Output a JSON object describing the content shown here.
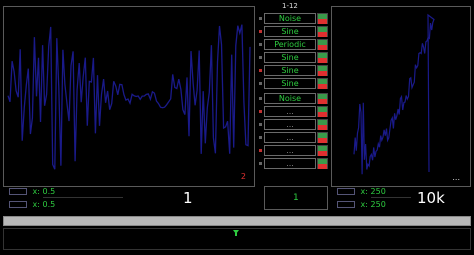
{
  "channel_range_label": "1-12",
  "channels": [
    {
      "label": "Noise",
      "dim": false
    },
    {
      "label": "Sine",
      "dim": false
    },
    {
      "label": "Periodic",
      "dim": false
    },
    {
      "label": "Sine",
      "dim": false
    },
    {
      "label": "Sine",
      "dim": false
    },
    {
      "label": "Sine",
      "dim": false
    },
    {
      "label": "Noise",
      "dim": false
    },
    {
      "label": "...",
      "dim": true
    },
    {
      "label": "...",
      "dim": true
    },
    {
      "label": "...",
      "dim": true
    },
    {
      "label": "...",
      "dim": true
    },
    {
      "label": "...",
      "dim": true
    }
  ],
  "left_plot": {
    "corner_label": "2",
    "x_control_top": "x: 0.5",
    "x_control_bottom": "x: 0.5",
    "value_display": "1"
  },
  "center": {
    "value_display": "1"
  },
  "right_plot": {
    "corner_label": "...",
    "x_control_top": "x: 250",
    "x_control_bottom": "x: 250",
    "value_display": "10k"
  },
  "colors": {
    "trace": "#1a1a8a",
    "green": "#2ecc40",
    "red": "#e03030"
  },
  "icons": [
    "slider-icon",
    "marker-icon"
  ]
}
